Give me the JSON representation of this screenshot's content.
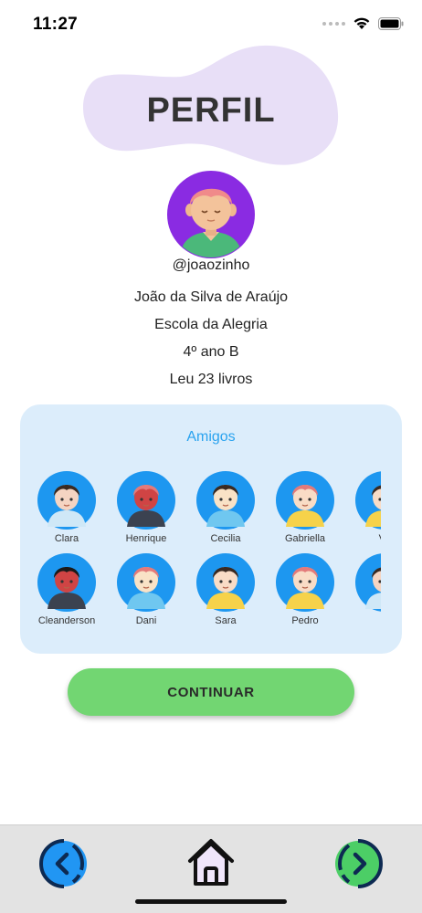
{
  "status_bar": {
    "time": "11:27"
  },
  "profile": {
    "title": "PERFIL",
    "username": "@joaozinho",
    "full_name": "João da Silva de Araújo",
    "school": "Escola da Alegria",
    "grade": "4º ano B",
    "books_read": "Leu 23 livros"
  },
  "friends": {
    "title": "Amigos",
    "rows": [
      [
        {
          "name": "Clara",
          "avatar": "girl-headphones-avatar"
        },
        {
          "name": "Henrique",
          "avatar": "boy-cap-avatar"
        },
        {
          "name": "Cecilia",
          "avatar": "baby-avatar"
        },
        {
          "name": "Gabriella",
          "avatar": "girl-bow-avatar"
        },
        {
          "name": "Va",
          "avatar": "girl-avatar"
        }
      ],
      [
        {
          "name": "Cleanderson",
          "avatar": "boy-green-cap-avatar"
        },
        {
          "name": "Dani",
          "avatar": "girl-bun-avatar"
        },
        {
          "name": "Sara",
          "avatar": "girl-bow-avatar"
        },
        {
          "name": "Pedro",
          "avatar": "girl-red-hair-avatar"
        },
        {
          "name": "J",
          "avatar": "boy-avatar"
        }
      ]
    ]
  },
  "continue_button": {
    "label": "CONTINUAR"
  },
  "bottom_nav": {
    "back": "back-icon",
    "home": "home-icon",
    "forward": "forward-icon"
  },
  "colors": {
    "avatar_circle": "#1d97f0",
    "profile_circle": "#8a2be2",
    "card_bg": "#dcedfb",
    "button_green": "#72d672",
    "blob": "#e8dff7"
  }
}
